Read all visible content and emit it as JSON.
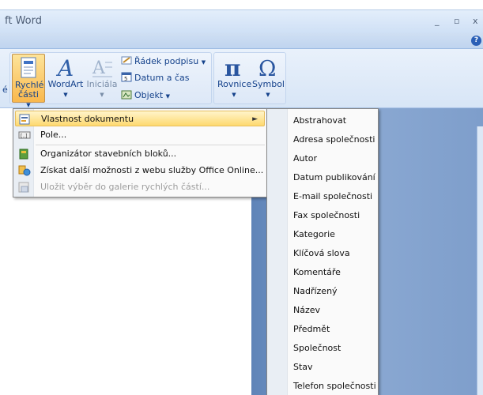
{
  "window": {
    "title": "ft Word",
    "minimize_glyph": "_",
    "restore_glyph": "▫",
    "close_glyph": "x",
    "help_glyph": "?"
  },
  "ribbon": {
    "left_edge_label": "é",
    "rychle_casti": "Rychlé části",
    "wordart": "WordArt",
    "inicialu": "Iniciála",
    "radek_podpisu": "Řádek podpisu",
    "datum_a_cas": "Datum a čas",
    "objekt": "Objekt",
    "rovnice": "Rovnice",
    "symbol": "Symbol"
  },
  "menu": {
    "items": [
      {
        "label": "Vlastnost dokumentu",
        "icon": "document-property-icon",
        "submenu": true
      },
      {
        "label": "Pole...",
        "icon": "field-icon"
      },
      {
        "label": "Organizátor stavebních bloků...",
        "icon": "building-blocks-icon"
      },
      {
        "label": "Získat další možnosti z webu služby Office Online...",
        "icon": "office-online-icon"
      },
      {
        "label": "Uložit výběr do galerie rychlých částí...",
        "icon": "save-gallery-icon",
        "disabled": true
      }
    ]
  },
  "submenu": {
    "items": [
      "Abstrahovat",
      "Adresa společnosti",
      "Autor",
      "Datum publikování",
      "E-mail společnosti",
      "Fax společnosti",
      "Kategorie",
      "Klíčová slova",
      "Komentáře",
      "Nadřízený",
      "Název",
      "Předmět",
      "Společnost",
      "Stav",
      "Telefon společnosti"
    ]
  },
  "colors": {
    "ribbon_accent": "#15428b",
    "highlight": "#fed96f",
    "document_background": "#7e9ecb"
  }
}
